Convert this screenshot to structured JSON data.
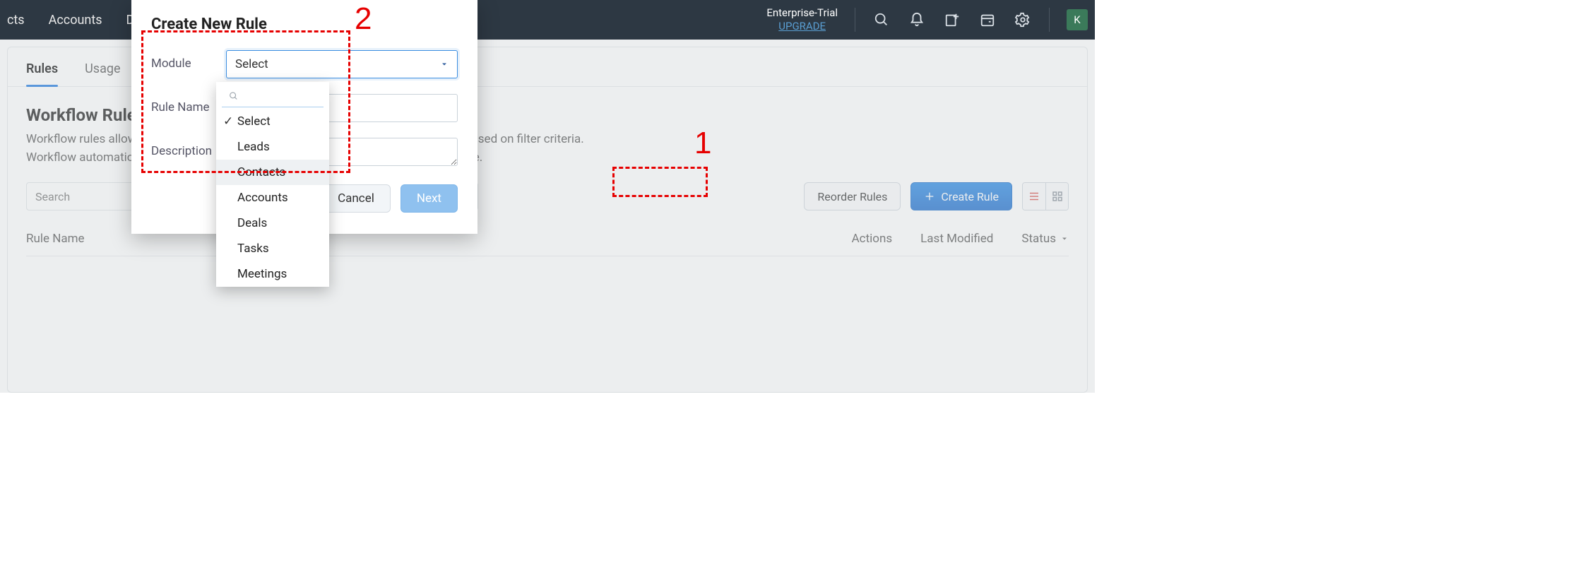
{
  "header": {
    "nav": [
      "cts",
      "Accounts",
      "Deals"
    ],
    "trial_line1": "Enterprise-Trial",
    "upgrade": "UPGRADE",
    "avatar": "K"
  },
  "tabs": {
    "rules": "Rules",
    "usage": "Usage"
  },
  "page": {
    "title": "Workflow Rules",
    "desc_line1": "Workflow rules allow you to perform certain automatic actions on specific records based on filter criteria.",
    "desc_line2": "Workflow automations can send emails, update fields, create records and much more.",
    "search_placeholder": "Search",
    "reorder": "Reorder Rules",
    "create": "Create Rule"
  },
  "table": {
    "col_name": "Rule Name",
    "col_actions": "Actions",
    "col_modified": "Last Modified",
    "col_status": "Status"
  },
  "modal": {
    "title": "Create New Rule",
    "module_label": "Module",
    "module_value": "Select",
    "name_label": "Rule Name",
    "desc_label": "Description",
    "cancel": "Cancel",
    "next": "Next"
  },
  "dropdown": {
    "search_placeholder": "",
    "items": [
      "Select",
      "Leads",
      "Contacts",
      "Accounts",
      "Deals",
      "Tasks",
      "Meetings"
    ],
    "selected_index": 0,
    "hover_index": 2
  },
  "annotations": {
    "one": "1",
    "two": "2"
  }
}
